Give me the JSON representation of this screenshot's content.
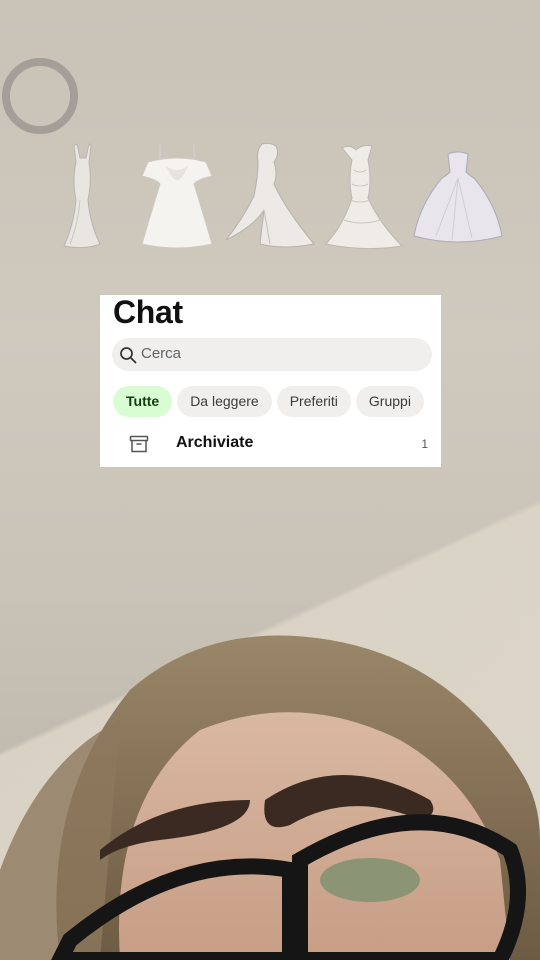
{
  "chat": {
    "title": "Chat",
    "search_placeholder": "Cerca",
    "filters": [
      {
        "label": "Tutte",
        "active": true
      },
      {
        "label": "Da leggere",
        "active": false
      },
      {
        "label": "Preferiti",
        "active": false
      },
      {
        "label": "Gruppi",
        "active": false
      }
    ],
    "archived": {
      "label": "Archiviate",
      "count": "1"
    }
  },
  "colors": {
    "active_chip_bg": "#d9fdd3",
    "chip_bg": "#f0efed",
    "card_bg": "#ffffff"
  },
  "icons": [
    "search-icon",
    "archive-icon"
  ]
}
